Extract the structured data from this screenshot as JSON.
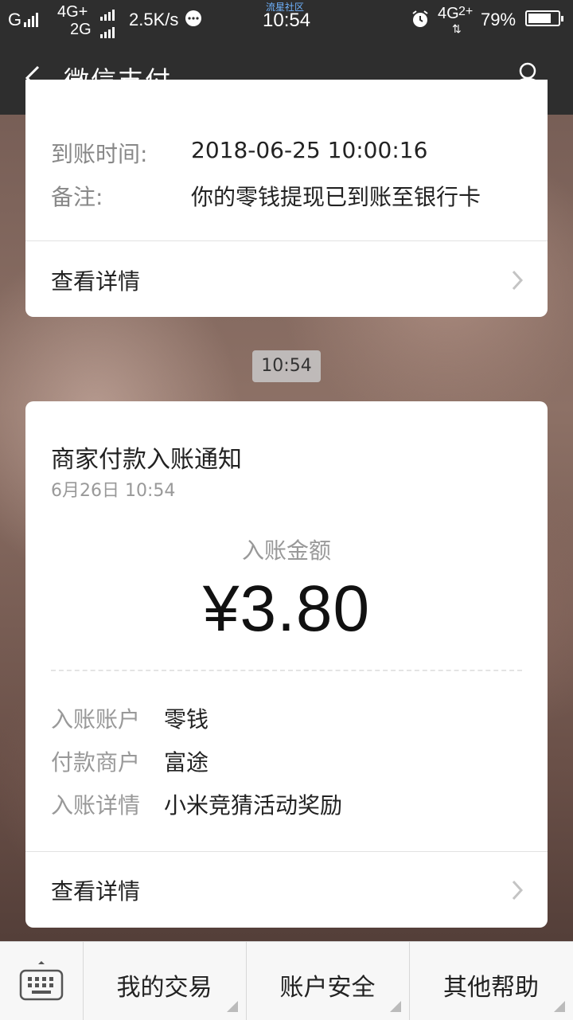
{
  "status_bar": {
    "carrier1": "G",
    "net_4g": "4G+",
    "net_2g": "2G",
    "speed": "2.5K/s",
    "watermark": "流星社区",
    "time": "10:54",
    "net_right": "4G",
    "net_right_sub": "2+",
    "battery": "79%"
  },
  "header": {
    "title": "微信支付"
  },
  "prev_card": {
    "rows": [
      {
        "label": "到账时间:",
        "value": "2018-06-25 10:00:16"
      },
      {
        "label": "备注:",
        "value": "你的零钱提现已到账至银行卡"
      }
    ],
    "link_label": "查看详情"
  },
  "timestamp": "10:54",
  "notice_card": {
    "title": "商家付款入账通知",
    "date": "6月26日  10:54",
    "amount_label": "入账金额",
    "amount": "¥3.80",
    "details": [
      {
        "label": "入账账户",
        "value": "零钱"
      },
      {
        "label": "付款商户",
        "value": "富途"
      },
      {
        "label": "入账详情",
        "value": "小米竞猜活动奖励"
      }
    ],
    "link_label": "查看详情"
  },
  "bottom_menu": {
    "items": [
      {
        "label": "我的交易"
      },
      {
        "label": "账户安全"
      },
      {
        "label": "其他帮助"
      }
    ]
  }
}
